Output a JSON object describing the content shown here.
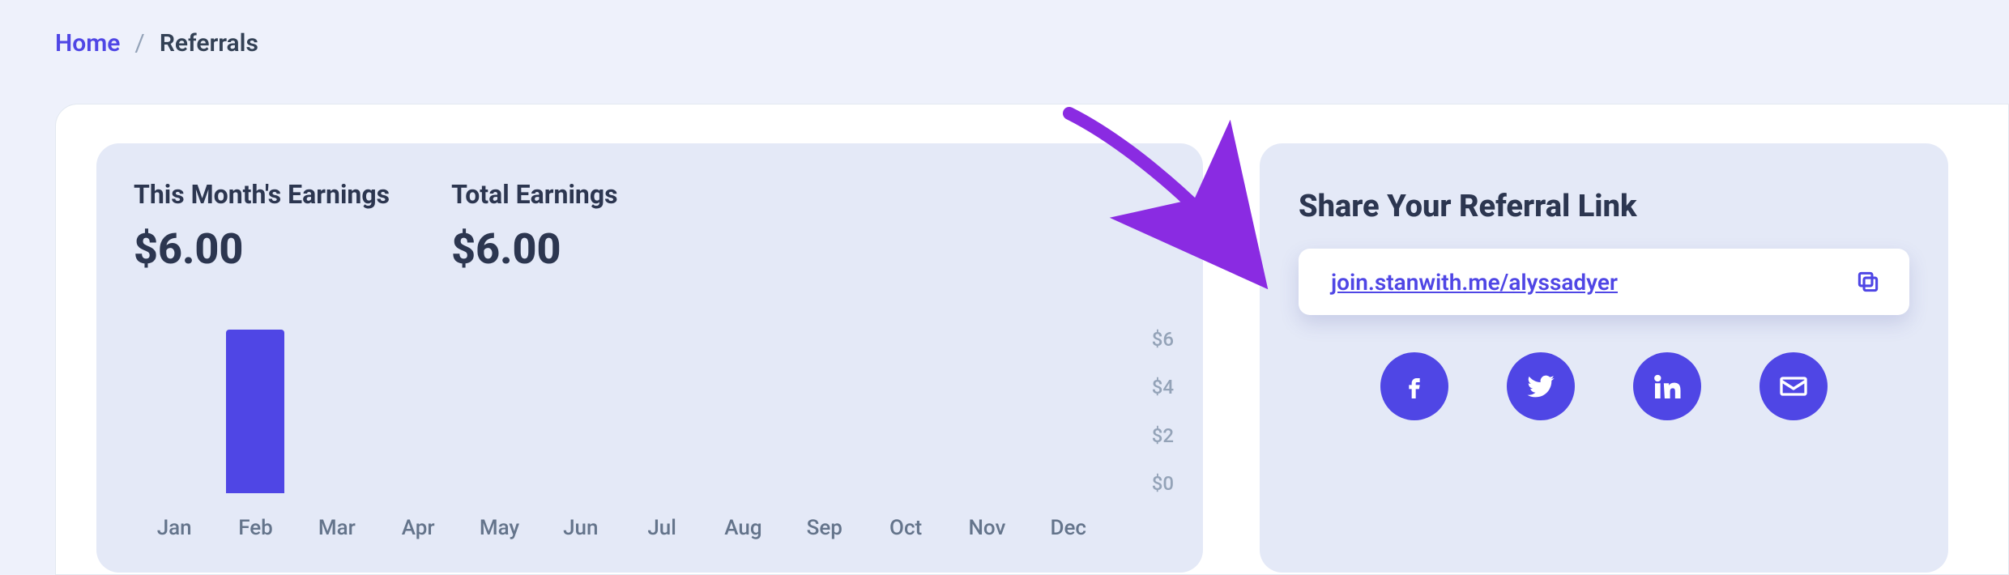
{
  "breadcrumb": {
    "home": "Home",
    "current": "Referrals"
  },
  "earnings": {
    "month_title": "This Month's Earnings",
    "month_value": "$6.00",
    "total_title": "Total Earnings",
    "total_value": "$6.00"
  },
  "chart_data": {
    "type": "bar",
    "categories": [
      "Jan",
      "Feb",
      "Mar",
      "Apr",
      "May",
      "Jun",
      "Jul",
      "Aug",
      "Sep",
      "Oct",
      "Nov",
      "Dec"
    ],
    "values": [
      0,
      6,
      0,
      0,
      0,
      0,
      0,
      0,
      0,
      0,
      0,
      0
    ],
    "y_ticks": [
      "$6",
      "$4",
      "$2",
      "$0"
    ],
    "ylim": [
      0,
      6
    ],
    "xlabel": "",
    "ylabel": "",
    "title": ""
  },
  "share": {
    "title": "Share Your Referral Link",
    "link": "join.stanwith.me/alyssadyer"
  },
  "colors": {
    "accent": "#4F46E5",
    "panel": "#E4E9F7",
    "text": "#2C3650",
    "muted": "#94A3B8"
  }
}
